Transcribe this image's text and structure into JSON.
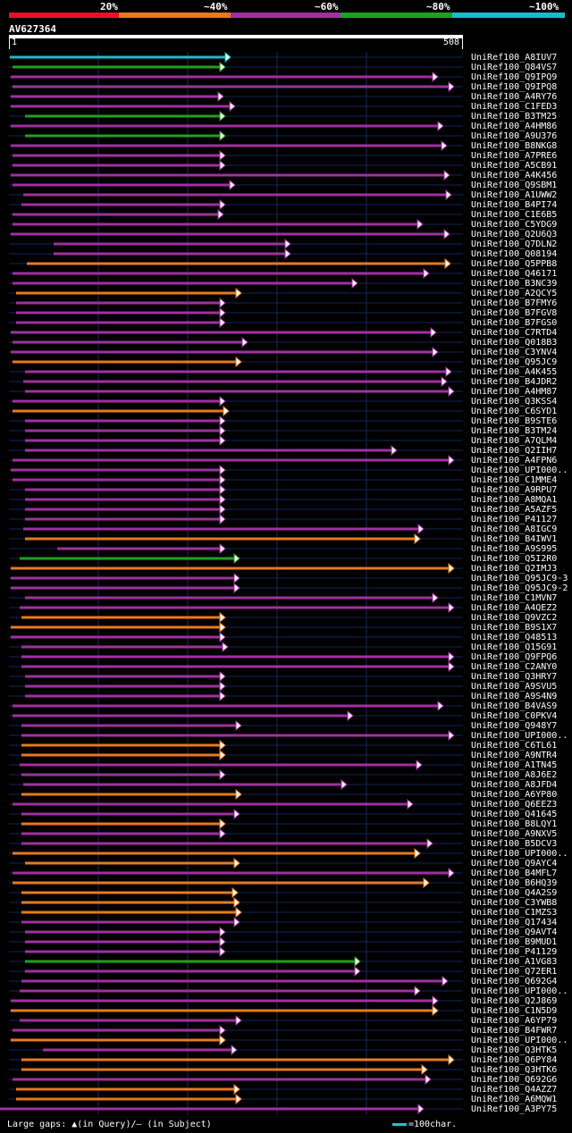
{
  "legend": {
    "labels": [
      "20%",
      "~40%",
      "~60%",
      "~80%",
      "~100%"
    ],
    "colors": [
      "#e8102c",
      "#e67a1e",
      "#a030a0",
      "#20a020",
      "#20b8c8"
    ]
  },
  "query": {
    "id": "AV627364",
    "start_label": "1",
    "end_label": "508"
  },
  "hits": [
    "UniRef100_A8IUV7",
    "UniRef100_Q84VS7",
    "UniRef100_Q9IPQ9",
    "UniRef100_Q9IPQ8",
    "UniRef100_A4RY76",
    "UniRef100_C1FED3",
    "UniRef100_B3TM25",
    "UniRef100_A4HM86",
    "UniRef100_A9U376",
    "UniRef100_B8NKG8",
    "UniRef100_A7PRE6",
    "UniRef100_A5CB91",
    "UniRef100_A4K456",
    "UniRef100_Q9SBM1",
    "UniRef100_A1UWW2",
    "UniRef100_B4PI74",
    "UniRef100_C1E6B5",
    "UniRef100_C5YDG9",
    "UniRef100_Q2U6Q3",
    "UniRef100_Q7DLN2",
    "UniRef100_Q08194",
    "UniRef100_Q5PPB8",
    "UniRef100_Q46171",
    "UniRef100_B3NC39",
    "UniRef100_A2QCY5",
    "UniRef100_B7FMY6",
    "UniRef100_B7FGV8",
    "UniRef100_B7FGS0",
    "UniRef100_C7RTD4",
    "UniRef100_Q018B3",
    "UniRef100_C3YNV4",
    "UniRef100_Q95JC9",
    "UniRef100_A4K455",
    "UniRef100_B4JDR2",
    "UniRef100_A4HM87",
    "UniRef100_Q3KSS4",
    "UniRef100_C6SYD1",
    "UniRef100_B9STE6",
    "UniRef100_B3TM24",
    "UniRef100_A7QLM4",
    "UniRef100_Q2IIH7",
    "UniRef100_A4FPN6",
    "UniRef100_UPI000..",
    "UniRef100_C1MME4",
    "UniRef100_A9RPU7",
    "UniRef100_A8MQA1",
    "UniRef100_A5AZF5",
    "UniRef100_P41127",
    "UniRef100_A8IGC9",
    "UniRef100_B4IWV1",
    "UniRef100_A9S995",
    "UniRef100_Q5I2R0",
    "UniRef100_Q2IMJ3",
    "UniRef100_Q95JC9-3",
    "UniRef100_Q95JC9-2",
    "UniRef100_C1MVN7",
    "UniRef100_A4QEZ2",
    "UniRef100_Q9VZC2",
    "UniRef100_B9S1X7",
    "UniRef100_Q48513",
    "UniRef100_Q15G91",
    "UniRef100_Q9FPQ6",
    "UniRef100_C2ANY0",
    "UniRef100_Q3HRY7",
    "UniRef100_A9SVU5",
    "UniRef100_A9S4N9",
    "UniRef100_B4VAS9",
    "UniRef100_C0PKV4",
    "UniRef100_Q948Y7",
    "UniRef100_UPI000..",
    "UniRef100_C6TL61",
    "UniRef100_A9NTR4",
    "UniRef100_A1TN45",
    "UniRef100_A8J6E2",
    "UniRef100_A8JFD4",
    "UniRef100_A6YP80",
    "UniRef100_Q6EEZ3",
    "UniRef100_Q41645",
    "UniRef100_B8LQY1",
    "UniRef100_A9NXV5",
    "UniRef100_B5DCV3",
    "UniRef100_UPI000..",
    "UniRef100_Q9AYC4",
    "UniRef100_B4MFL7",
    "UniRef100_B6HQ39",
    "UniRef100_Q4A2S9",
    "UniRef100_C3YWB8",
    "UniRef100_C1MZS3",
    "UniRef100_Q17434",
    "UniRef100_Q9AVT4",
    "UniRef100_B9MUD1",
    "UniRef100_P41129",
    "UniRef100_A1VG83",
    "UniRef100_Q72ER1",
    "UniRef100_Q692G4",
    "UniRef100_UPI000..",
    "UniRef100_Q2J869",
    "UniRef100_C1N5D9",
    "UniRef100_A6YP79",
    "UniRef100_B4FWR7",
    "UniRef100_UPI000..",
    "UniRef100_Q3HTK5",
    "UniRef100_Q6PY84",
    "UniRef100_Q3HTK6",
    "UniRef100_Q692G6",
    "UniRef100_Q4AZZ7",
    "UniRef100_A6MQW1",
    "UniRef100_A3PY75"
  ],
  "footer": {
    "large_gaps": "Large gaps: ▲(in Query)/— (in Subject)",
    "scale": "=100char."
  }
}
